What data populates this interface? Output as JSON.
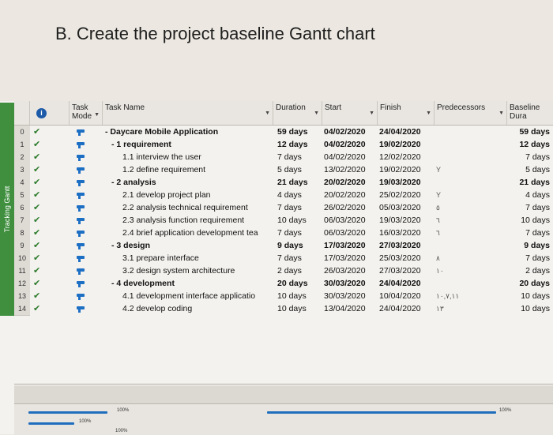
{
  "heading": "B. Create the project baseline Gantt chart",
  "side_tab": "Tracking Gantt",
  "columns": {
    "task_mode": "Task Mode",
    "task_name": "Task Name",
    "duration": "Duration",
    "start": "Start",
    "finish": "Finish",
    "predecessors": "Predecessors",
    "baseline_duration": "Baseline Dura"
  },
  "rows": [
    {
      "id": "0",
      "name": "- Daycare Mobile Application",
      "duration": "59 days",
      "start": "04/02/2020",
      "finish": "24/04/2020",
      "pred": "",
      "base": "59 days",
      "level": 0,
      "bold": true
    },
    {
      "id": "1",
      "name": "- 1 requirement",
      "duration": "12 days",
      "start": "04/02/2020",
      "finish": "19/02/2020",
      "pred": "",
      "base": "12 days",
      "level": 1,
      "bold": true
    },
    {
      "id": "2",
      "name": "1.1 interview the user",
      "duration": "7 days",
      "start": "04/02/2020",
      "finish": "12/02/2020",
      "pred": "",
      "base": "7 days",
      "level": 2,
      "bold": false
    },
    {
      "id": "3",
      "name": "1.2 define requirement",
      "duration": "5 days",
      "start": "13/02/2020",
      "finish": "19/02/2020",
      "pred": "Y",
      "base": "5 days",
      "level": 2,
      "bold": false
    },
    {
      "id": "4",
      "name": "- 2 analysis",
      "duration": "21 days",
      "start": "20/02/2020",
      "finish": "19/03/2020",
      "pred": "",
      "base": "21 days",
      "level": 1,
      "bold": true
    },
    {
      "id": "5",
      "name": "2.1 develop project plan",
      "duration": "4 days",
      "start": "20/02/2020",
      "finish": "25/02/2020",
      "pred": "Y",
      "base": "4 days",
      "level": 2,
      "bold": false
    },
    {
      "id": "6",
      "name": "2.2 analysis technical requirement",
      "duration": "7 days",
      "start": "26/02/2020",
      "finish": "05/03/2020",
      "pred": "٥",
      "base": "7 days",
      "level": 2,
      "bold": false
    },
    {
      "id": "7",
      "name": "2.3 analysis function requirement",
      "duration": "10 days",
      "start": "06/03/2020",
      "finish": "19/03/2020",
      "pred": "٦",
      "base": "10 days",
      "level": 2,
      "bold": false
    },
    {
      "id": "8",
      "name": "2.4 brief application development tea",
      "duration": "7 days",
      "start": "06/03/2020",
      "finish": "16/03/2020",
      "pred": "٦",
      "base": "7 days",
      "level": 2,
      "bold": false
    },
    {
      "id": "9",
      "name": "- 3 design",
      "duration": "9 days",
      "start": "17/03/2020",
      "finish": "27/03/2020",
      "pred": "",
      "base": "9 days",
      "level": 1,
      "bold": true
    },
    {
      "id": "10",
      "name": "3.1 prepare interface",
      "duration": "7 days",
      "start": "17/03/2020",
      "finish": "25/03/2020",
      "pred": "٨",
      "base": "7 days",
      "level": 2,
      "bold": false
    },
    {
      "id": "11",
      "name": "3.2 design system architecture",
      "duration": "2 days",
      "start": "26/03/2020",
      "finish": "27/03/2020",
      "pred": "١٠",
      "base": "2 days",
      "level": 2,
      "bold": false
    },
    {
      "id": "12",
      "name": "- 4 development",
      "duration": "20 days",
      "start": "30/03/2020",
      "finish": "24/04/2020",
      "pred": "",
      "base": "20 days",
      "level": 1,
      "bold": true
    },
    {
      "id": "13",
      "name": "4.1 development interface applicatio",
      "duration": "10 days",
      "start": "30/03/2020",
      "finish": "10/04/2020",
      "pred": "١٠,٧,١١",
      "base": "10 days",
      "level": 2,
      "bold": false
    },
    {
      "id": "14",
      "name": "4.2 develop coding",
      "duration": "10 days",
      "start": "13/04/2020",
      "finish": "24/04/2020",
      "pred": "١٣",
      "base": "10 days",
      "level": 2,
      "bold": false
    }
  ],
  "timeline": {
    "labels": [
      "100%",
      "100%",
      "100%",
      "100%"
    ]
  },
  "colors": {
    "accent": "#1f6dbd",
    "tab": "#3f8f3f",
    "check": "#2a7a2a"
  }
}
